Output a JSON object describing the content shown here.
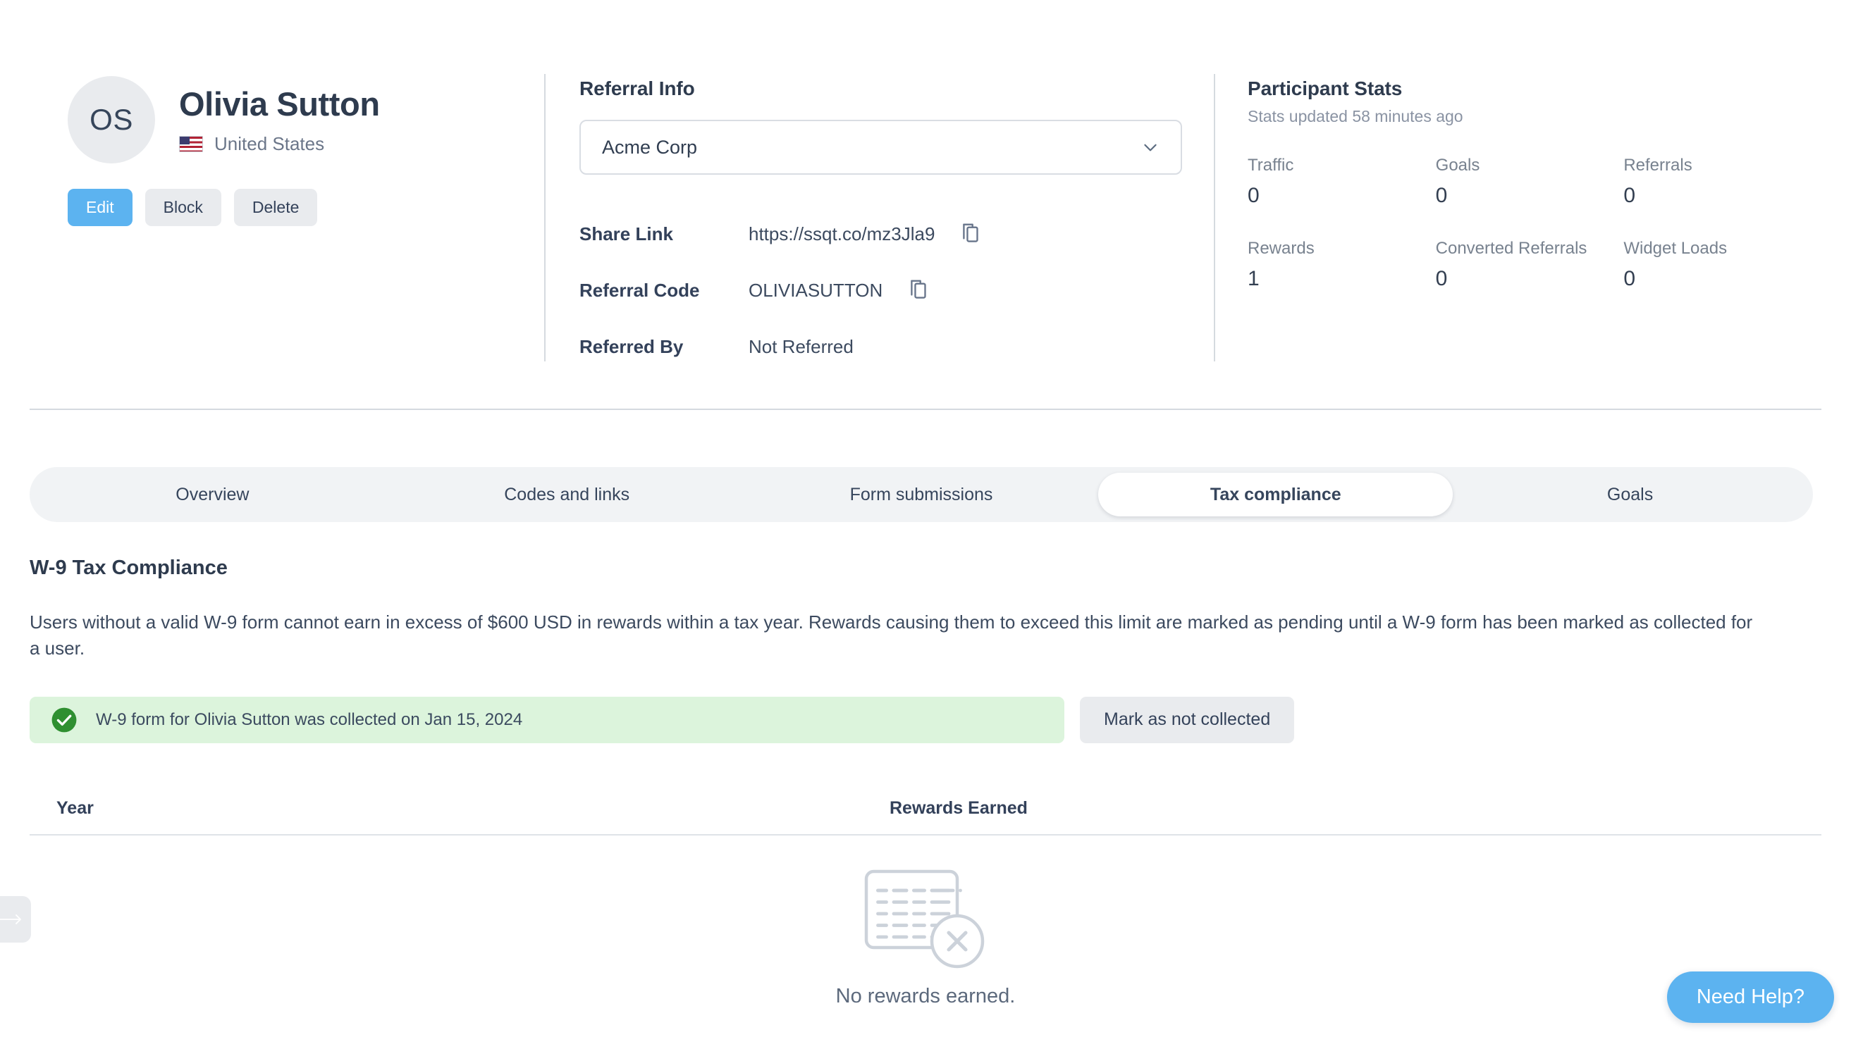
{
  "profile": {
    "initials": "OS",
    "name": "Olivia Sutton",
    "country": "United States",
    "flag": "🇺🇸",
    "flag_icon_name": "us-flag-icon",
    "actions": {
      "edit": "Edit",
      "block": "Block",
      "delete": "Delete"
    }
  },
  "referral": {
    "title": "Referral Info",
    "program_selected": "Acme Corp",
    "rows": [
      {
        "label": "Share Link",
        "value": "https://ssqt.co/mz3Jla9",
        "copyable": true
      },
      {
        "label": "Referral Code",
        "value": "OLIVIASUTTON",
        "copyable": true
      },
      {
        "label": "Referred By",
        "value": "Not Referred",
        "copyable": false
      }
    ]
  },
  "stats": {
    "title": "Participant Stats",
    "updated": "Stats updated 58 minutes ago",
    "items": [
      {
        "label": "Traffic",
        "value": "0"
      },
      {
        "label": "Goals",
        "value": "0"
      },
      {
        "label": "Referrals",
        "value": "0"
      },
      {
        "label": "Rewards",
        "value": "1"
      },
      {
        "label": "Converted Referrals",
        "value": "0"
      },
      {
        "label": "Widget Loads",
        "value": "0"
      }
    ]
  },
  "tabs": {
    "active": "Tax compliance",
    "items": [
      {
        "label": "Overview",
        "active": false
      },
      {
        "label": "Codes and links",
        "active": false
      },
      {
        "label": "Form submissions",
        "active": false
      },
      {
        "label": "Tax compliance",
        "active": true
      },
      {
        "label": "Goals",
        "active": false
      }
    ]
  },
  "tax": {
    "title": "W-9 Tax Compliance",
    "description": "Users without a valid W-9 form cannot earn in excess of $600 USD in rewards within a tax year. Rewards causing them to exceed this limit are marked as pending until a W-9 form has been marked as collected for a user.",
    "banner_text": "W-9 form for Olivia Sutton was collected on Jan 15, 2024",
    "mark_button": "Mark as not collected",
    "banner_color": "#dcf4dc",
    "check_color": "#2f8f31"
  },
  "table": {
    "columns": [
      "Year",
      "Rewards Earned"
    ],
    "rows": [],
    "empty_message": "No rewards earned."
  },
  "floating": {
    "need_help": "Need Help?",
    "collapse_icon": "arrow-right-icon"
  },
  "theme": {
    "accent": "#5cb3f0",
    "text": "#2e3b4e",
    "muted": "#78828f",
    "surface": "#e9ebee",
    "divider": "#d5dadf"
  }
}
